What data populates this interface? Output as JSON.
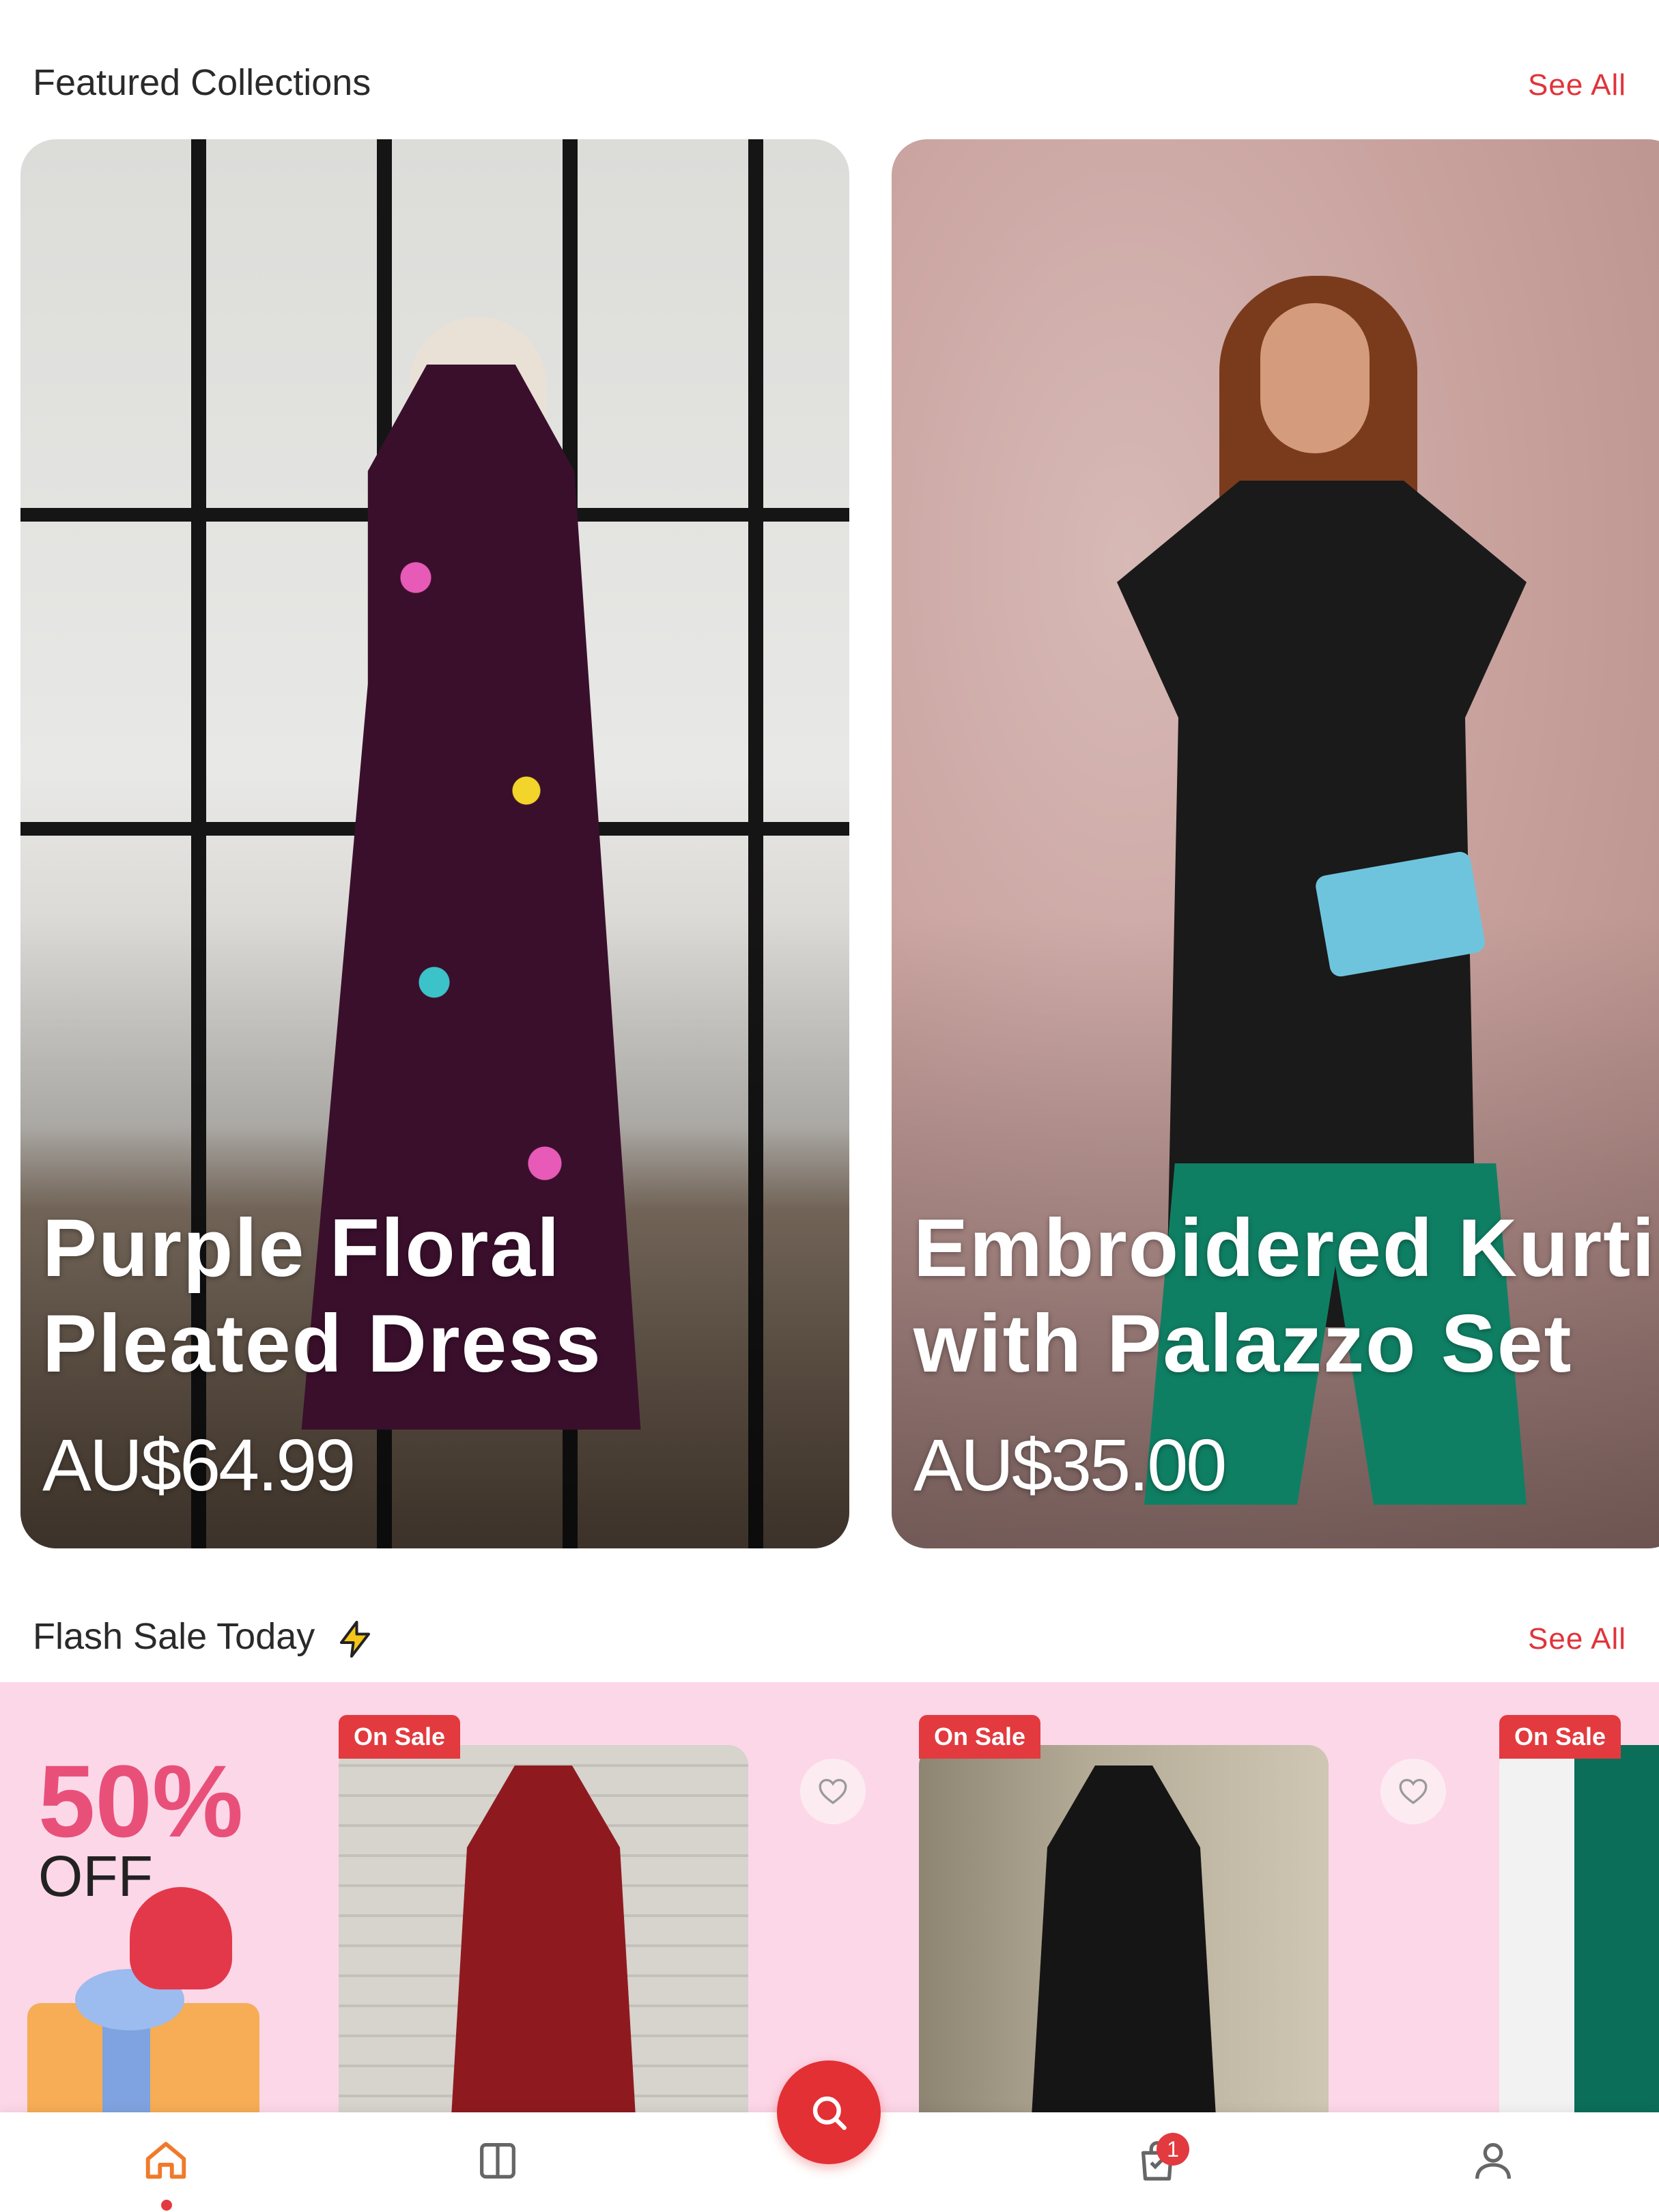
{
  "featured": {
    "title": "Featured Collections",
    "see_all": "See All",
    "cards": [
      {
        "name": "Purple Floral\nPleated Dress",
        "price": "AU$64.99"
      },
      {
        "name": "Embroidered Kurti\nwith Palazzo Set",
        "price": "AU$35.00"
      }
    ]
  },
  "flash": {
    "title": "Flash Sale Today",
    "see_all": "See All",
    "promo_percent": "50%",
    "promo_off": "OFF",
    "badge": "On Sale"
  },
  "nav": {
    "cart_count": "1"
  },
  "colors": {
    "accent": "#e23a3f",
    "flash_bg": "#fcd7e8",
    "promo_pink": "#e8507a"
  },
  "icons": [
    "lightning-icon",
    "heart-outline-icon",
    "search-icon",
    "home-icon",
    "catalog-icon",
    "cart-icon",
    "user-icon"
  ]
}
